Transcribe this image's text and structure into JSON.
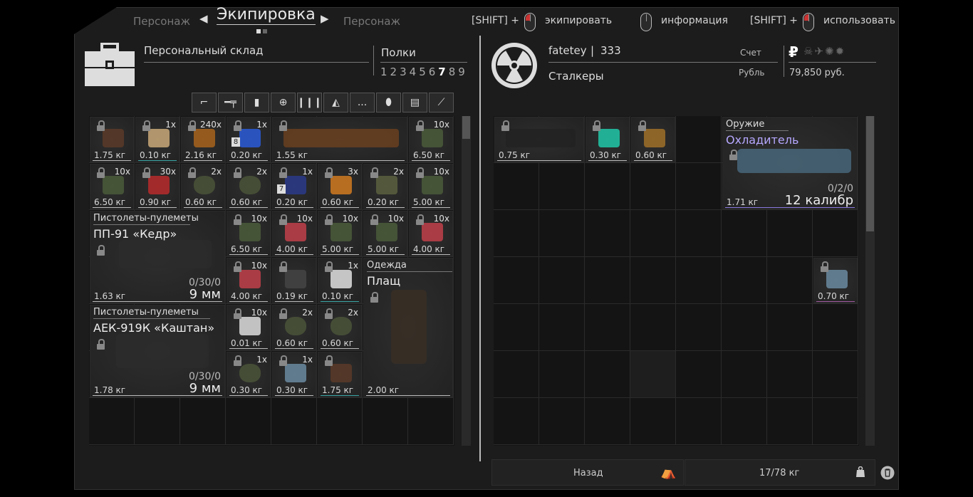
{
  "nav": {
    "prev_tab": "Персонаж",
    "current_tab": "Экипировка",
    "next_tab": "Персонаж"
  },
  "hints": [
    {
      "modifier": "[SHIFT] +",
      "label": "экипировать",
      "button": "left"
    },
    {
      "modifier": "",
      "label": "информация",
      "button": "none"
    },
    {
      "modifier": "[SHIFT] +",
      "label": "использовать",
      "button": "left"
    }
  ],
  "stash": {
    "title": "Персональный склад",
    "shelves_label": "Полки",
    "shelves": [
      "1",
      "2",
      "3",
      "4",
      "5",
      "6",
      "7",
      "8",
      "9"
    ],
    "active_shelf": "7",
    "categories": [
      "pistol-icon",
      "rifle-icon",
      "armor-icon",
      "medkit-icon",
      "ammo-icon",
      "artifact-icon",
      "misc-icon",
      "grenade-icon",
      "backpack-icon",
      "knife-icon"
    ],
    "misc_label": "...",
    "items": [
      {
        "w": "1.75 кг",
        "cnt": "",
        "icon": "bag-item"
      },
      {
        "w": "0.10 кг",
        "cnt": "1x",
        "icon": "food-item",
        "style": "teal"
      },
      {
        "w": "2.16 кг",
        "cnt": "240x",
        "icon": "ammo-item"
      },
      {
        "w": "0.20 кг",
        "cnt": "1x",
        "icon": "energy-drink",
        "badge": "8"
      },
      {
        "w": "1.55 кг",
        "cnt": "",
        "icon": "shotgun-item"
      },
      {
        "w": "6.50 кг",
        "cnt": "10x",
        "icon": "ammo-box"
      },
      {
        "w": "6.50 кг",
        "cnt": "10x",
        "icon": "ammo-box"
      },
      {
        "w": "0.90 кг",
        "cnt": "30x",
        "icon": "shells-item"
      },
      {
        "w": "0.60 кг",
        "cnt": "2x",
        "icon": "grenade-item"
      },
      {
        "w": "0.60 кг",
        "cnt": "2x",
        "icon": "grenade-item"
      },
      {
        "w": "0.20 кг",
        "cnt": "1x",
        "icon": "injector-item",
        "badge": "7"
      },
      {
        "w": "0.60 кг",
        "cnt": "3x",
        "icon": "ration-item"
      },
      {
        "w": "0.20 кг",
        "cnt": "2x",
        "icon": "bandage-item"
      },
      {
        "w": "5.00 кг",
        "cnt": "10x",
        "icon": "ammo-box"
      },
      {
        "w": "6.50 кг",
        "cnt": "10x",
        "icon": "ammo-box"
      },
      {
        "w": "4.00 кг",
        "cnt": "10x",
        "icon": "medkit-item"
      },
      {
        "w": "5.00 кг",
        "cnt": "10x",
        "icon": "ammo-box"
      },
      {
        "w": "5.00 кг",
        "cnt": "10x",
        "icon": "ammo-box"
      },
      {
        "w": "4.00 кг",
        "cnt": "10x",
        "icon": "medkit-item"
      },
      {
        "w": "4.00 кг",
        "cnt": "10x",
        "icon": "medkit-item"
      },
      {
        "w": "0.19 кг",
        "cnt": "",
        "icon": "knife-item"
      },
      {
        "w": "0.10 кг",
        "cnt": "1x",
        "icon": "bread-item",
        "style": "teal"
      },
      {
        "w": "0.01 кг",
        "cnt": "10x",
        "icon": "bolts-item"
      },
      {
        "w": "0.60 кг",
        "cnt": "2x",
        "icon": "grenade-item"
      },
      {
        "w": "0.60 кг",
        "cnt": "2x",
        "icon": "grenade-item"
      },
      {
        "w": "0.30 кг",
        "cnt": "1x",
        "icon": "grenade-item"
      },
      {
        "w": "0.30 кг",
        "cnt": "1x",
        "icon": "crystal-item"
      },
      {
        "w": "1.75 кг",
        "cnt": "",
        "icon": "bag-item",
        "style": "teal"
      }
    ],
    "weapons": [
      {
        "category": "Пистолеты-пулеметы",
        "name": "ПП-91 «Кедр»",
        "ammo": "0/30/0",
        "caliber": "9 мм",
        "w": "1.63 кг"
      },
      {
        "category": "Пистолеты-пулеметы",
        "name": "АЕК-919К «Каштан»",
        "ammo": "0/30/0",
        "caliber": "9 мм",
        "w": "1.78 кг"
      }
    ],
    "clothing": {
      "category": "Одежда",
      "name": "Плащ",
      "w": "2.00 кг"
    }
  },
  "profile": {
    "name": "fatetey",
    "separator": "|",
    "level": "333",
    "faction": "Сталкеры",
    "account_label": "Счет",
    "currency_label": "Рубль",
    "currency_symbol": "₽",
    "balance": "79,850 руб."
  },
  "equip": {
    "items": [
      {
        "w": "0.75 кг",
        "icon": "scope-item"
      },
      {
        "w": "0.30 кг",
        "icon": "artifact-item"
      },
      {
        "w": "0.60 кг",
        "icon": "detector-item"
      },
      {
        "w": "0.70 кг",
        "icon": "crystal-item",
        "style": "purple"
      }
    ],
    "weapon": {
      "category": "Оружие",
      "name": "Охладитель",
      "ammo": "0/2/0",
      "caliber": "12 калибр",
      "w": "1.71 кг"
    }
  },
  "footer": {
    "back": "Назад",
    "weight": "17/78 кг"
  },
  "colors": {
    "weapon_name_accent": "#b6a7ff",
    "lock": "#888888",
    "teal_underline": "#3aa4a4",
    "purple_underline": "#a05aa0"
  }
}
